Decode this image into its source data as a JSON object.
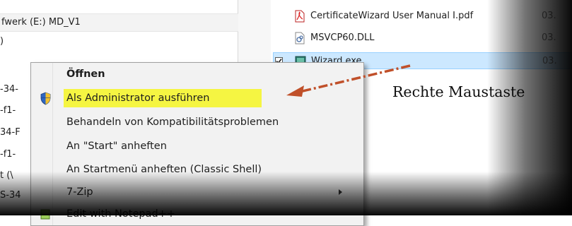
{
  "nav_pane": {
    "drive_label": "fwerk (E:) MD_V1",
    "rows": [
      ")",
      "-34-",
      "-f1-",
      "34-F",
      "-f1-",
      "t (\\",
      "S-34"
    ]
  },
  "file_list": {
    "files": [
      {
        "name": "CertificateWizard User Manual I.pdf",
        "date": "03.",
        "icon": "pdf-icon",
        "selected": false
      },
      {
        "name": "MSVCP60.DLL",
        "date": "03.",
        "icon": "dll-icon",
        "selected": false
      },
      {
        "name": "Wizard.exe",
        "date": "03.",
        "icon": "exe-icon",
        "selected": true
      }
    ]
  },
  "context_menu": {
    "items": [
      {
        "label": "Öffnen",
        "bold": true
      },
      {
        "label": "Als Administrator ausführen",
        "icon": "uac-shield-icon",
        "highlighted": true
      },
      {
        "label": "Behandeln von Kompatibilitätsproblemen"
      },
      {
        "label": "An \"Start\" anheften"
      },
      {
        "label": "An Startmenü anheften (Classic Shell)"
      },
      {
        "label": "7-Zip",
        "submenu": true
      },
      {
        "label": "Edit with Notepad++",
        "icon": "notepad-plus-icon"
      }
    ]
  },
  "annotation": {
    "text": "Rechte Maustaste",
    "arrow_color": "#c0502a",
    "highlight_color": "#f5f542"
  },
  "colors": {
    "selection_bg": "#cce8ff",
    "selection_border": "#99d1ff",
    "menu_bg": "#f2f2f2"
  }
}
